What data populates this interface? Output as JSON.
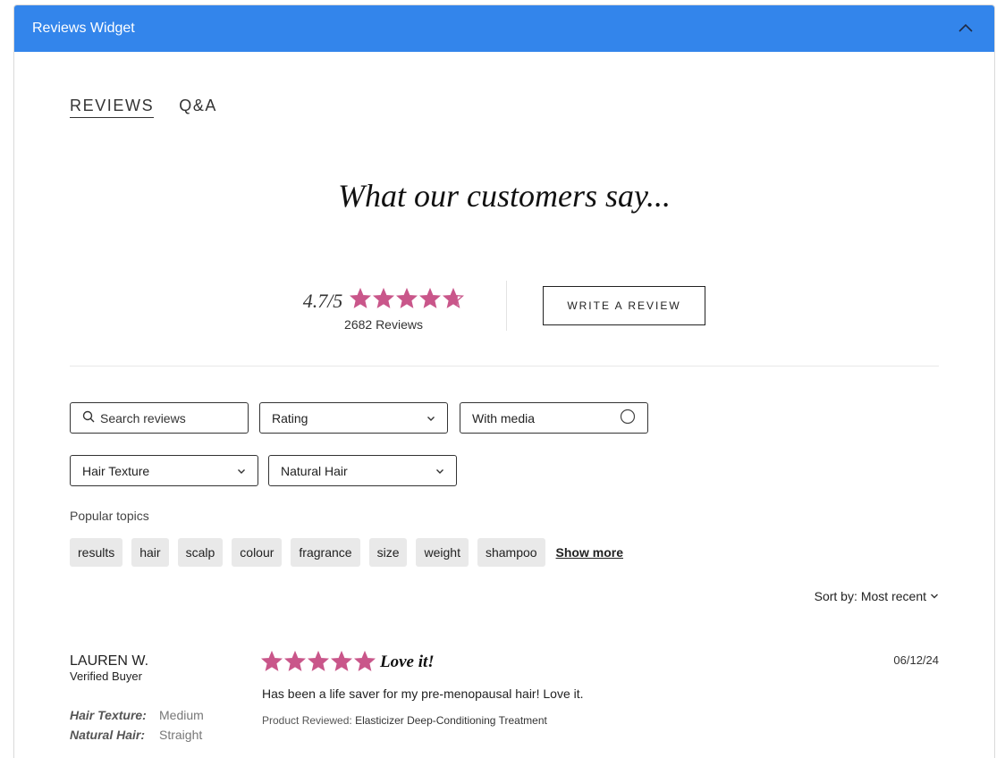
{
  "widget": {
    "title": "Reviews Widget"
  },
  "tabs": [
    {
      "label": "REVIEWS",
      "active": true
    },
    {
      "label": "Q&A",
      "active": false
    }
  ],
  "headline": "What our customers say...",
  "summary": {
    "average": "4.7/5",
    "rating_value": 4.7,
    "review_count": "2682 Reviews",
    "write_review_label": "WRITE A REVIEW"
  },
  "filters": {
    "search_placeholder": "Search reviews",
    "rating_label": "Rating",
    "media_label": "With media",
    "hair_texture_label": "Hair Texture",
    "natural_hair_label": "Natural Hair"
  },
  "topics": {
    "label": "Popular topics",
    "items": [
      "results",
      "hair",
      "scalp",
      "colour",
      "fragrance",
      "size",
      "weight",
      "shampoo"
    ],
    "show_more": "Show more"
  },
  "sort": {
    "label": "Sort by:",
    "value": "Most recent"
  },
  "review": {
    "author": "LAUREN W.",
    "badge": "Verified Buyer",
    "attributes": [
      {
        "key": "Hair Texture:",
        "value": "Medium"
      },
      {
        "key": "Natural Hair:",
        "value": "Straight"
      }
    ],
    "rating": 5,
    "title": "Love it!",
    "date": "06/12/24",
    "body": "Has been a life saver for my pre-menopausal hair! Love it.",
    "product_label": "Product Reviewed:",
    "product_name": "Elasticizer Deep-Conditioning Treatment"
  },
  "colors": {
    "header": "#3385eb",
    "star": "#c9568a"
  },
  "icons": {
    "collapse": "chevron-up-icon",
    "search": "search-icon",
    "dropdown": "chevron-down-icon",
    "media_toggle": "radio-circle-icon",
    "star": "star-icon"
  }
}
